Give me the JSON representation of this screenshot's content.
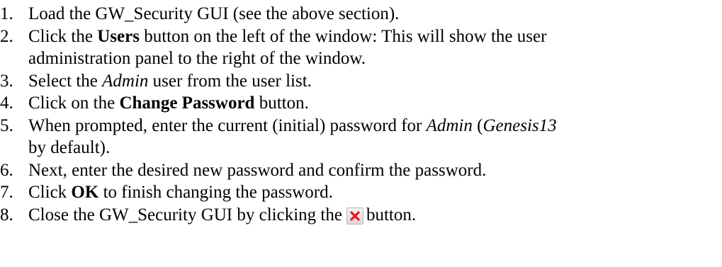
{
  "steps": [
    {
      "num": "1.",
      "t1": "Load the GW_Security GUI (see the above section)."
    },
    {
      "num": "2.",
      "t1": "Click the ",
      "b1": "Users",
      "t2": " button on the left of the window:  This will show the user",
      "t3": "administration panel to the right of the window."
    },
    {
      "num": "3.",
      "t1": "Select the ",
      "i1": "Admin",
      "t2": " user from the user list."
    },
    {
      "num": "4.",
      "t1": "Click on the ",
      "b1": "Change Password",
      "t2": " button."
    },
    {
      "num": "5.",
      "t1": "When prompted, enter the current (initial) password for ",
      "i1": "Admin",
      "t2": " (",
      "i2": "Genesis13",
      "t3": "by default)."
    },
    {
      "num": "6.",
      "t1": "Next, enter the desired new password and confirm the password."
    },
    {
      "num": "7.",
      "t1": "Click ",
      "b1": "OK",
      "t2": " to finish changing the password."
    },
    {
      "num": "8.",
      "t1": "Close the GW_Security GUI by clicking the",
      "t2": "button.",
      "icon": "close-x-icon",
      "icon_color": "#e8171e"
    }
  ]
}
